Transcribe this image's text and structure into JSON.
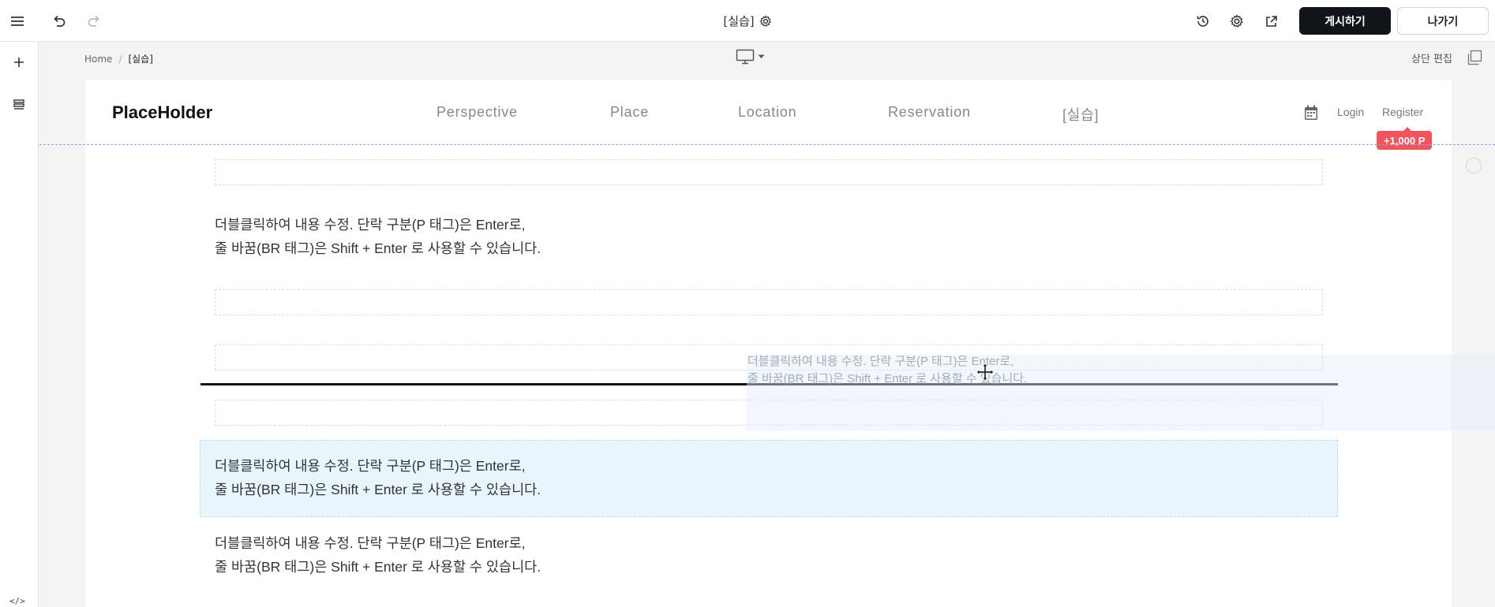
{
  "toolbar": {
    "menu_icon": "hamburger-icon",
    "undo_icon": "undo-icon",
    "redo_icon": "redo-icon",
    "title": "[실습]",
    "title_settings_icon": "gear-icon",
    "history_icon": "history-icon",
    "settings_icon": "gear-icon",
    "preview_icon": "external-link-icon",
    "publish_label": "게시하기",
    "exit_label": "나가기"
  },
  "left_rail": {
    "add_icon": "plus-icon",
    "layers_icon": "layers-icon",
    "code_icon": "code-icon",
    "code_label": "</>"
  },
  "breadcrumb": {
    "home": "Home",
    "separator": "/",
    "current": "[실습]"
  },
  "device": {
    "icon": "desktop-icon",
    "dropdown_icon": "caret-down-icon"
  },
  "header_edit": {
    "label": "상단 편집",
    "icon": "copy-icon"
  },
  "site": {
    "logo": "PlaceHolder",
    "nav": [
      "Perspective",
      "Place",
      "Location",
      "Reservation",
      "[실습]"
    ],
    "calendar_icon": "calendar-icon",
    "login": "Login",
    "register": "Register",
    "points_badge": "+1,000 P"
  },
  "content": {
    "paragraph_line1": "더블클릭하여 내용 수정. 단락 구분(P 태그)은 Enter로,",
    "paragraph_line2": "줄 바꿈(BR 태그)은 Shift + Enter 로 사용할 수 있습니다."
  },
  "colors": {
    "publish_bg": "#111418",
    "badge_bg": "#f0545d",
    "selected_bg": "#e8f5fc",
    "guide_line": "#8fa6e8"
  }
}
